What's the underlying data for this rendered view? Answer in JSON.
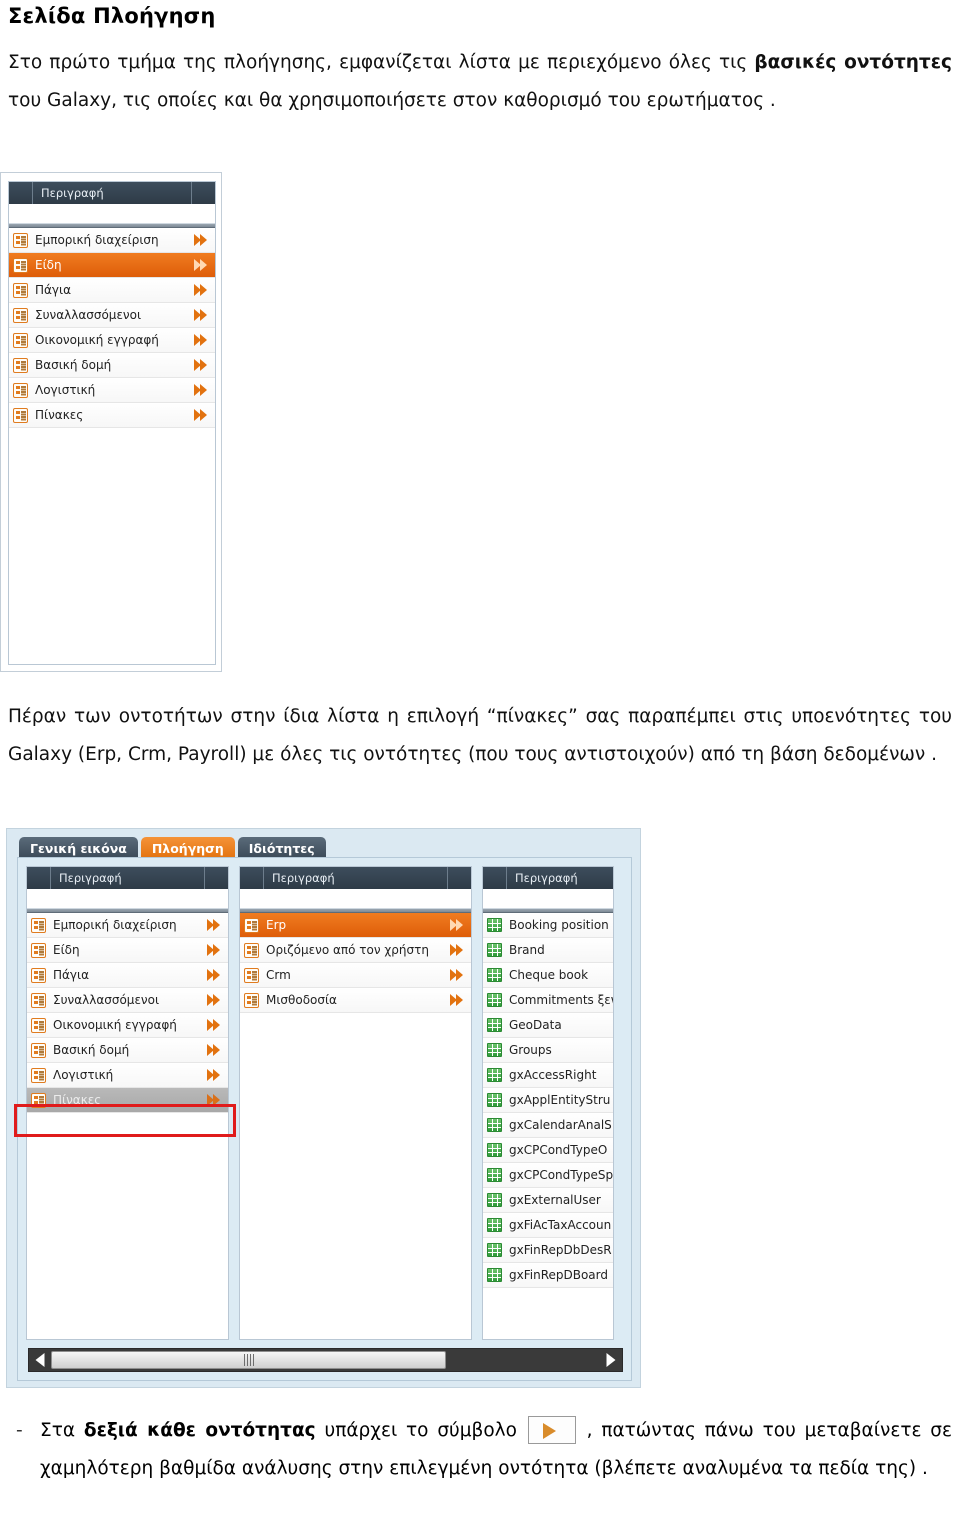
{
  "document": {
    "heading": "Σελίδα Πλοήγηση",
    "intro_paragraph_html": "Στο πρώτο τμήμα της πλοήγησης, εμφανίζεται λίστα με περιεχόμενο όλες τις <b>βασικές οντότητες</b> του Galaxy, τις οποίες και θα χρησιμοποιήσετε στον καθορισμό του ερωτήματος .",
    "middle_paragraph_html": "Πέραν των οντοτήτων στην ίδια λίστα η επιλογή “πίνακες” σας παραπέμπει στις υποενότητες του Galaxy (Erp, Crm, Payroll) με όλες τις οντότητες (που τους αντιστοιχούν) από τη βάση δεδομένων .",
    "bullet": {
      "dash": "-",
      "part1_html": "Στα <b>δεξιά κάθε οντότητας</b> υπάρχει το σύμβολο",
      "part2_html": ", πατώντας πάνω του μεταβαίνετε σε χαμηλότερη βαθμίδα ανάλυσης στην επιλεγμένη οντότητα (βλέπετε αναλυμένα τα πεδία της) ."
    }
  },
  "screenshot1": {
    "panel": {
      "column_header": "Περιγραφή",
      "rows": [
        {
          "label": "Εμπορική διαχείριση",
          "selected": false
        },
        {
          "label": "Είδη",
          "selected": true
        },
        {
          "label": "Πάγια",
          "selected": false
        },
        {
          "label": "Συναλλασσόμενοι",
          "selected": false
        },
        {
          "label": "Οικονομική εγγραφή",
          "selected": false
        },
        {
          "label": "Βασική δομή",
          "selected": false
        },
        {
          "label": "Λογιστική",
          "selected": false
        },
        {
          "label": "Πίνακες",
          "selected": false
        }
      ]
    }
  },
  "screenshot2": {
    "tabs": [
      {
        "label": "Γενική εικόνα",
        "active": false
      },
      {
        "label": "Πλοήγηση",
        "active": true
      },
      {
        "label": "Ιδιότητες",
        "active": false
      }
    ],
    "column1": {
      "column_header": "Περιγραφή",
      "rows": [
        {
          "label": "Εμπορική διαχείριση",
          "state": "normal"
        },
        {
          "label": "Είδη",
          "state": "normal"
        },
        {
          "label": "Πάγια",
          "state": "normal"
        },
        {
          "label": "Συναλλασσόμενοι",
          "state": "normal"
        },
        {
          "label": "Οικονομική εγγραφή",
          "state": "normal"
        },
        {
          "label": "Βασική δομή",
          "state": "normal"
        },
        {
          "label": "Λογιστική",
          "state": "normal"
        },
        {
          "label": "Πίνακες",
          "state": "annotated"
        }
      ]
    },
    "column2": {
      "column_header": "Περιγραφή",
      "rows": [
        {
          "label": "Erp",
          "state": "selected"
        },
        {
          "label": "Οριζόμενο από τον χρήστη",
          "state": "normal"
        },
        {
          "label": "Crm",
          "state": "normal"
        },
        {
          "label": "Μισθοδοσία",
          "state": "normal"
        }
      ]
    },
    "column3": {
      "column_header": "Περιγραφή",
      "rows": [
        {
          "label": "Booking position"
        },
        {
          "label": "Brand"
        },
        {
          "label": "Cheque book"
        },
        {
          "label": "Commitments ξεν"
        },
        {
          "label": "GeoData"
        },
        {
          "label": "Groups"
        },
        {
          "label": "gxAccessRight"
        },
        {
          "label": "gxApplEntityStru"
        },
        {
          "label": "gxCalendarAnalS"
        },
        {
          "label": "gxCPCondTypeO"
        },
        {
          "label": "gxCPCondTypeSp"
        },
        {
          "label": "gxExternalUser"
        },
        {
          "label": "gxFiAcTaxAccoun"
        },
        {
          "label": "gxFinRepDbDesR"
        },
        {
          "label": "gxFinRepDBoard"
        }
      ]
    },
    "scrollbar": {
      "left_arrow": "◀",
      "right_arrow": "▶"
    }
  },
  "colors": {
    "accent_orange": "#e2720f",
    "selected_row_orange": "#de5d09",
    "header_dark": "#2e3b47",
    "panel_bg_blue": "#dcebf4",
    "annotation_red": "#e01b1b",
    "table_icon_green": "#2f9a3a"
  }
}
